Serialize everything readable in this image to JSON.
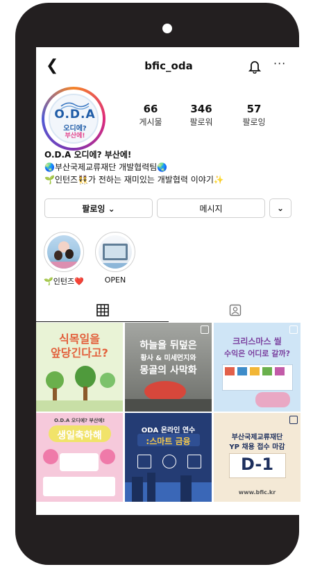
{
  "profile": {
    "username": "bfic_oda",
    "back_icon": "chevron-left-icon",
    "bell_icon": "bell-icon",
    "more_icon": "more-icon",
    "avatar_logo": {
      "big": "O.D.A",
      "line1": "오디에?",
      "line2": "부산에!"
    }
  },
  "stats": [
    {
      "value": "66",
      "label": "게시물"
    },
    {
      "value": "346",
      "label": "팔로워"
    },
    {
      "value": "57",
      "label": "팔로잉"
    }
  ],
  "bio": {
    "name": "O.D.A 오디에? 부산에!",
    "line1": "🌏부산국제교류재단 개발협력팀🌏",
    "line2": "🌱인턴즈👯가 전하는 재미있는 개발협력 이야기✨"
  },
  "buttons": {
    "following": "팔로잉 ⌄",
    "message": "메시지",
    "dropdown": "⌄"
  },
  "highlights": [
    {
      "label": "🌱인턴즈❤️"
    },
    {
      "label": "OPEN"
    }
  ],
  "tabs": {
    "grid_icon": "grid-icon",
    "tagged_icon": "tagged-user-icon"
  },
  "posts": [
    {
      "title1": "식목일을",
      "title2": "앞당긴다고?",
      "bg": "#e9f3d6",
      "fg": "#e25f3b"
    },
    {
      "title1": "하늘을 뒤덮은",
      "title2": "황사 & 미세먼지와",
      "title3": "몽골의 사막화",
      "bg": "#8c8f8a",
      "fg": "#ffffff"
    },
    {
      "title1": "크리스마스 씰",
      "title2": "수익은 어디로 갈까?",
      "bg": "#cfe5f6",
      "fg": "#7a3f9e"
    },
    {
      "title1": "O.D.A 오디에? 부산에!",
      "title2": "생일축하해",
      "bg": "#f6c9db",
      "fg": "#ffffff"
    },
    {
      "title1": "ODA 온라인 연수",
      "title2": ":스마트 금융",
      "bg": "#243c74",
      "fg": "#ffffff"
    },
    {
      "title1": "부산국제교류재단",
      "title2": "YP 채용 접수 마감",
      "title3": "D-1",
      "site": "www.bfic.kr",
      "bg": "#f4e9d6",
      "fg": "#1d2f5d"
    }
  ]
}
